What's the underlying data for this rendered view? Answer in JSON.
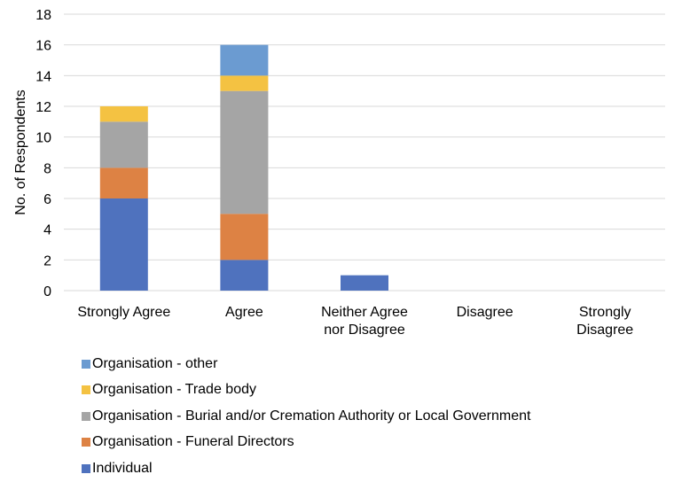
{
  "chart_data": {
    "type": "bar",
    "stacked": true,
    "title": "",
    "xlabel": "",
    "ylabel": "No. of Respondents",
    "ylim": [
      0,
      18
    ],
    "yticks": [
      0,
      2,
      4,
      6,
      8,
      10,
      12,
      14,
      16,
      18
    ],
    "grid": true,
    "legend_position": "bottom-left",
    "categories": [
      [
        "Strongly Agree"
      ],
      [
        "Agree"
      ],
      [
        "Neither Agree",
        "nor Disagree"
      ],
      [
        "Disagree"
      ],
      [
        "Strongly",
        "Disagree"
      ]
    ],
    "series": [
      {
        "name": "Individual",
        "color": "#4f72be",
        "values": [
          6,
          2,
          1,
          0,
          0
        ]
      },
      {
        "name": "Organisation - Funeral Directors",
        "color": "#dd8244",
        "values": [
          2,
          3,
          0,
          0,
          0
        ]
      },
      {
        "name": "Organisation - Burial and/or Cremation Authority or Local Government",
        "color": "#a5a5a5",
        "values": [
          3,
          8,
          0,
          0,
          0
        ]
      },
      {
        "name": "Organisation - Trade body",
        "color": "#f4c242",
        "values": [
          1,
          1,
          0,
          0,
          0
        ]
      },
      {
        "name": "Organisation - other",
        "color": "#6b9bd1",
        "values": [
          0,
          2,
          0,
          0,
          0
        ]
      }
    ],
    "legend_order": [
      4,
      3,
      2,
      1,
      0
    ]
  }
}
